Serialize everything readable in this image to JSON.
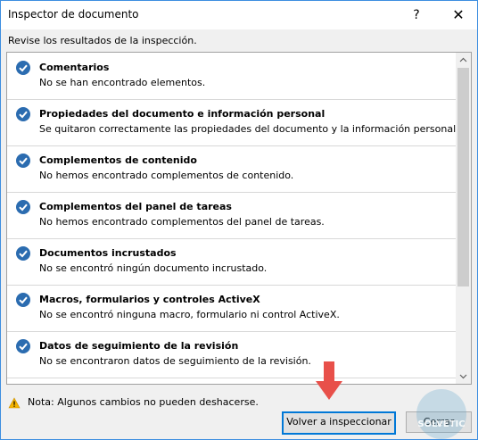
{
  "window": {
    "title": "Inspector de documento",
    "help_label": "?",
    "close_label": "✕"
  },
  "subtitle": "Revise los resultados de la inspección.",
  "items": [
    {
      "title": "Comentarios",
      "desc": "No se han encontrado elementos."
    },
    {
      "title": "Propiedades del documento e información personal",
      "desc": "Se quitaron correctamente las propiedades del documento y la información personal."
    },
    {
      "title": "Complementos de contenido",
      "desc": "No hemos encontrado complementos de contenido."
    },
    {
      "title": "Complementos del panel de tareas",
      "desc": "No hemos encontrado complementos del panel de tareas."
    },
    {
      "title": "Documentos incrustados",
      "desc": "No se encontró ningún documento incrustado."
    },
    {
      "title": "Macros, formularios y controles ActiveX",
      "desc": "No se encontró ninguna macro, formulario ni control ActiveX."
    },
    {
      "title": "Datos de seguimiento de la revisión",
      "desc": "No se encontraron datos de seguimiento de la revisión."
    }
  ],
  "note": "Nota: Algunos cambios no pueden deshacerse.",
  "buttons": {
    "reinspect": "Volver a inspeccionar",
    "close": "Cerrar"
  },
  "watermark": "SOLVETIC",
  "colors": {
    "check": "#2b6cb0",
    "warning": "#f5b400",
    "arrow": "#e8504a",
    "focus": "#0078d7"
  },
  "icons": {
    "item": "check-circle-icon",
    "note": "warning-icon",
    "annotation": "red-arrow-down-icon"
  }
}
